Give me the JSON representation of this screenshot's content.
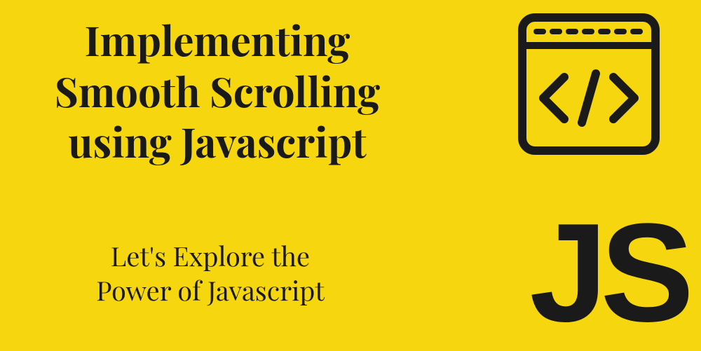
{
  "title_line1": "Implementing",
  "title_line2": "Smooth  Scrolling",
  "title_line3": "using Javascript",
  "subtitle_line1": "Let's Explore the",
  "subtitle_line2": "Power of Javascript",
  "js_label": "JS",
  "colors": {
    "background": "#f5d60f",
    "text": "#1a1a1a"
  }
}
